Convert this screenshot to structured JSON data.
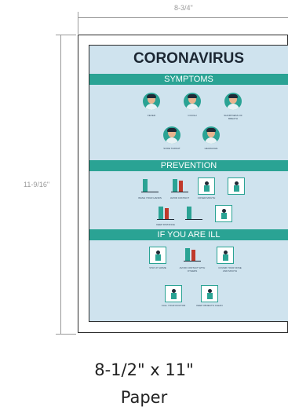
{
  "dimensions": {
    "width_label": "8-3/4\"",
    "height_label": "11-9/16\""
  },
  "poster": {
    "title": "CORONAVIRUS",
    "sections": {
      "symptoms": "SYMPTOMS",
      "prevention": "PREVENTION",
      "if_ill": "IF YOU ARE ILL"
    },
    "symptom_captions": [
      "FEVER",
      "COUGH",
      "SHORTNESS OF BREATH",
      "SORE THROAT",
      "HEADACHE"
    ],
    "prevention_captions": [
      "WASH YOUR HANDS",
      "AVOID CONTACT",
      "COVER MOUTH",
      "WEAR A MASK",
      "KEEP DISTANCE",
      "DO NOT TOUCH FACE",
      "DISINFECT"
    ],
    "ill_captions": [
      "STAY AT HOME",
      "AVOID CONTACT WITH OTHERS",
      "COVER YOUR NOSE AND MOUTH",
      "CALL YOUR DOCTOR",
      "KEEP OBJECTS CLEAN"
    ]
  },
  "paper": {
    "size": "8-1/2\" x 11\"",
    "word": "Paper"
  }
}
